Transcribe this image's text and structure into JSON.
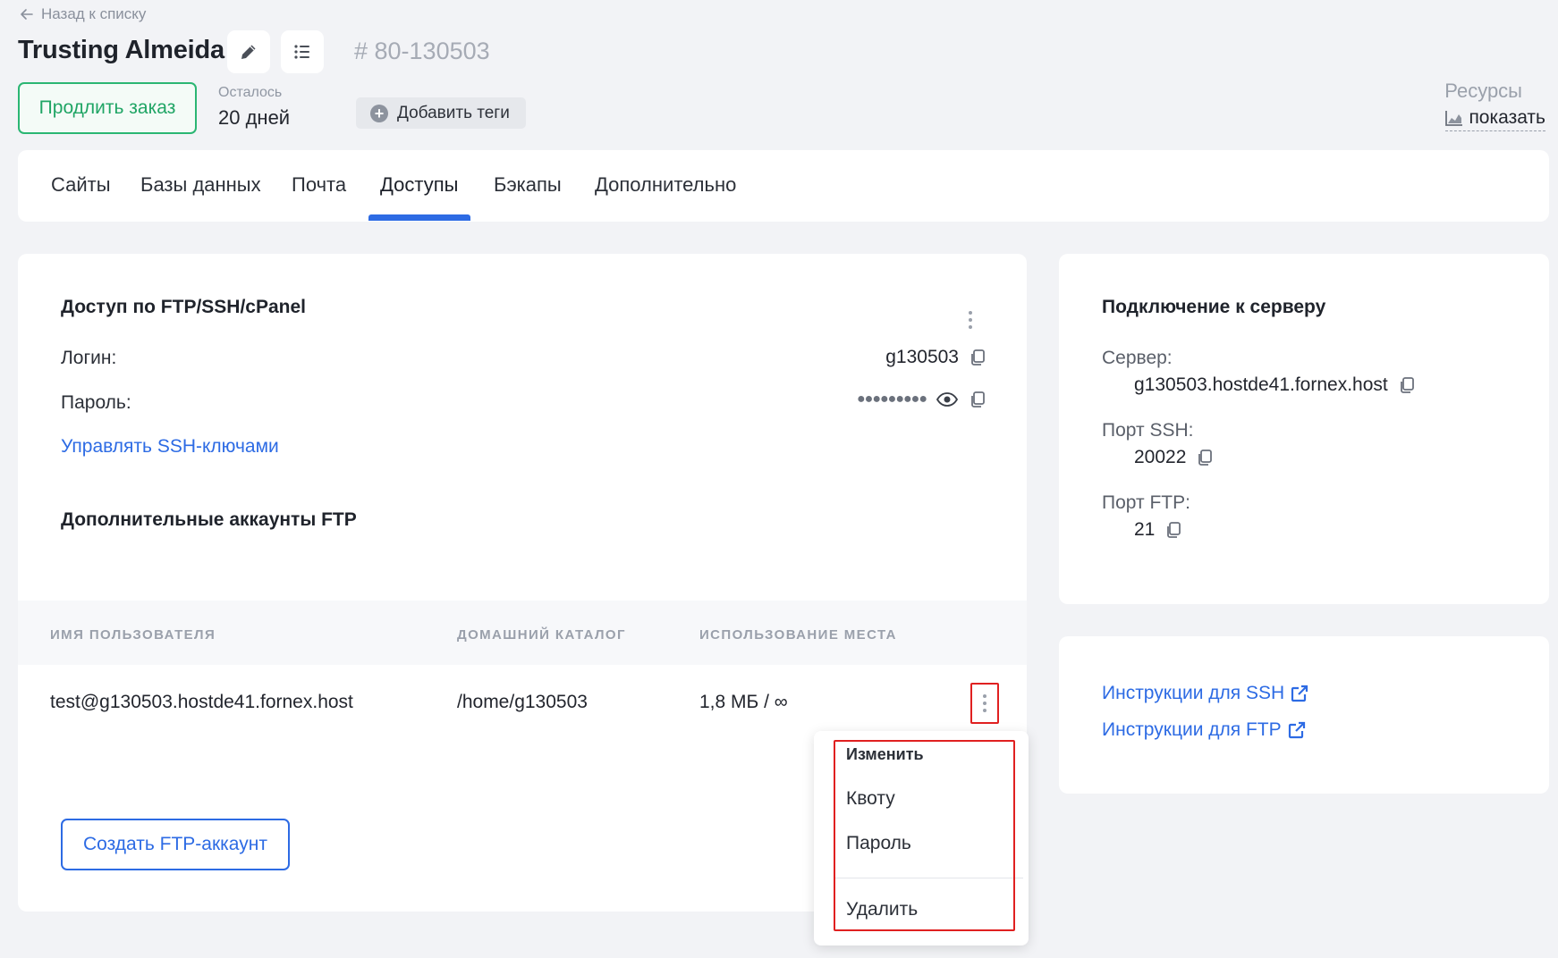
{
  "header": {
    "back_label": "Назад к списку",
    "title": "Trusting Almeida",
    "order_id": "# 80-130503",
    "extend_label": "Продлить заказ",
    "remain_label": "Осталось",
    "remain_value": "20 дней",
    "tags_label": "Добавить теги",
    "resources_label": "Ресурсы",
    "resources_show": "показать"
  },
  "tabs": [
    {
      "label": "Сайты"
    },
    {
      "label": "Базы данных"
    },
    {
      "label": "Почта"
    },
    {
      "label": "Доступы"
    },
    {
      "label": "Бэкапы"
    },
    {
      "label": "Дополнительно"
    }
  ],
  "access": {
    "title": "Доступ по FTP/SSH/cPanel",
    "login_label": "Логин:",
    "login_value": "g130503",
    "password_label": "Пароль:",
    "password_mask": "●●●●●●●●●",
    "ssh_keys_link": "Управлять SSH-ключами",
    "extra_title": "Дополнительные аккаунты FTP"
  },
  "table": {
    "headers": [
      "ИМЯ ПОЛЬЗОВАТЕЛЯ",
      "ДОМАШНИЙ КАТАЛОГ",
      "ИСПОЛЬЗОВАНИЕ МЕСТА"
    ],
    "rows": [
      {
        "user": "test@g130503.hostde41.fornex.host",
        "home": "/home/g130503",
        "usage": "1,8 МБ / ∞"
      }
    ]
  },
  "create_button": "Создать FTP-аккаунт",
  "menu": {
    "items": [
      "Изменить",
      "Квоту",
      "Пароль",
      "Удалить"
    ]
  },
  "server": {
    "title": "Подключение к серверу",
    "server_label": "Сервер:",
    "server_value": "g130503.hostde41.fornex.host",
    "ssh_port_label": "Порт SSH:",
    "ssh_port_value": "20022",
    "ftp_port_label": "Порт FTP:",
    "ftp_port_value": "21"
  },
  "instructions": {
    "ssh": "Инструкции для SSH",
    "ftp": "Инструкции для FTP"
  },
  "colors": {
    "accent": "#2d6be4",
    "green": "#2bb673",
    "highlight": "#e02020"
  }
}
